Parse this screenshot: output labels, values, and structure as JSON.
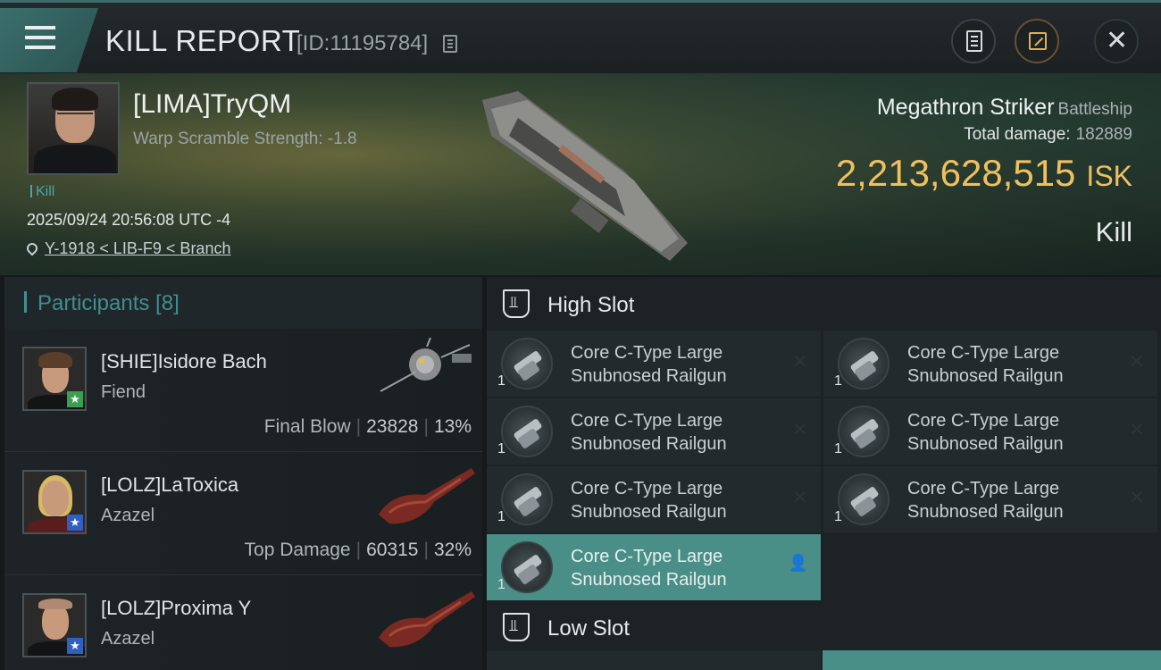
{
  "header": {
    "title": "KILL REPORT",
    "report_id": "[ID:11195784]"
  },
  "victim": {
    "name": "[LIMA]TryQM",
    "warp_scramble": "Warp Scramble Strength: -1.8",
    "tag": "Kill",
    "timestamp": "2025/09/24 20:56:08 UTC -4",
    "location": "Y-1918 < LIB-F9 < Branch",
    "ship_name": "Megathron Striker",
    "ship_class": "Battleship",
    "total_damage_label": "Total damage:",
    "total_damage": "182889",
    "isk_value": "2,213,628,515",
    "isk_unit": "ISK",
    "result": "Kill"
  },
  "participants": {
    "title": "Participants [8]",
    "rows": [
      {
        "name": "[SHIE]Isidore Bach",
        "ship": "Fiend",
        "stat_label": "Final Blow",
        "damage": "23828",
        "percent": "13%"
      },
      {
        "name": "[LOLZ]LaToxica",
        "ship": "Azazel",
        "stat_label": "Top Damage",
        "damage": "60315",
        "percent": "32%"
      },
      {
        "name": "[LOLZ]Proxima Y",
        "ship": "Azazel"
      }
    ]
  },
  "slots": {
    "high_title": "High Slot",
    "low_title": "Low Slot",
    "modules": [
      {
        "name": "Core C-Type Large Snubnosed Railgun",
        "qty": "1"
      },
      {
        "name": "Core C-Type Large Snubnosed Railgun",
        "qty": "1"
      },
      {
        "name": "Core C-Type Large Snubnosed Railgun",
        "qty": "1"
      },
      {
        "name": "Core C-Type Large Snubnosed Railgun",
        "qty": "1"
      },
      {
        "name": "Core C-Type Large Snubnosed Railgun",
        "qty": "1"
      },
      {
        "name": "Core C-Type Large Snubnosed Railgun",
        "qty": "1"
      },
      {
        "name": "Core C-Type Large Snubnosed Railgun",
        "qty": "1"
      }
    ]
  },
  "colors": {
    "accent": "#3f8f90",
    "isk": "#f0c060",
    "highlight": "#4a8e88"
  }
}
